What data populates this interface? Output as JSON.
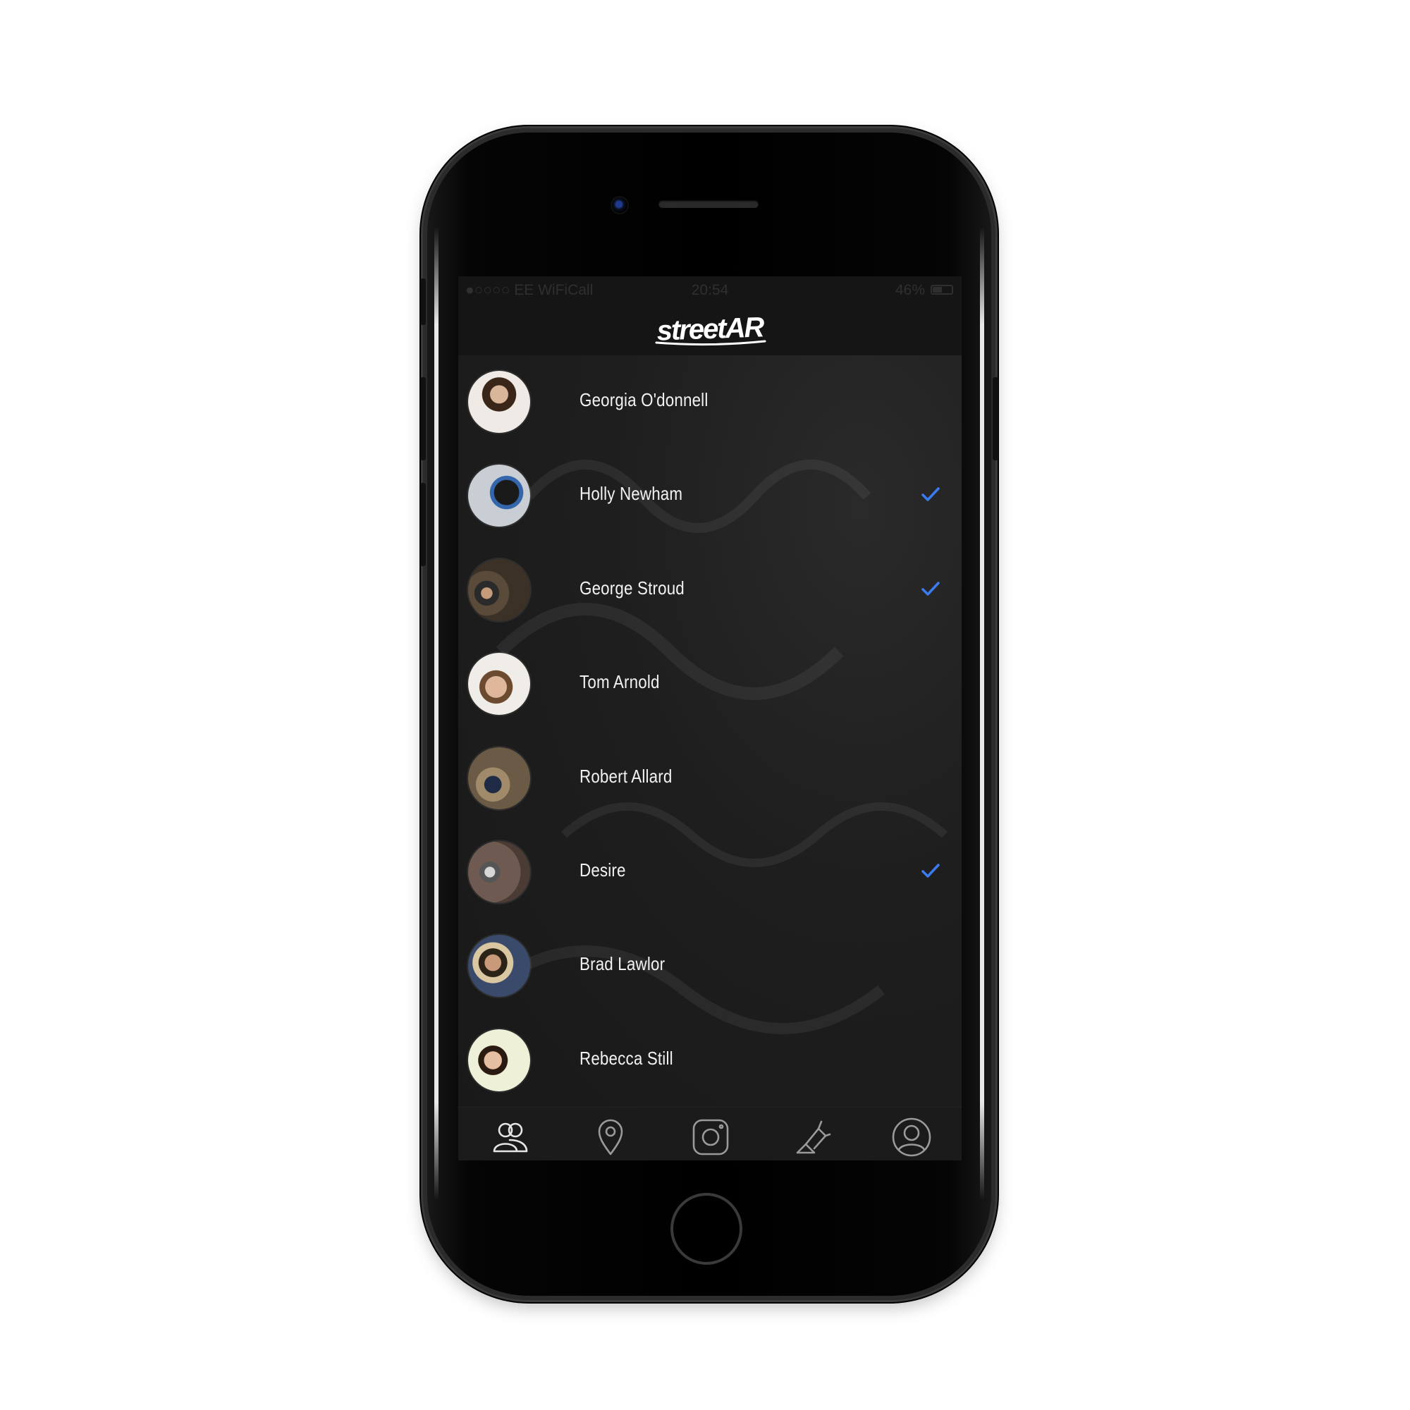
{
  "app": {
    "logo_text": "streetAR"
  },
  "status_bar": {
    "carrier": "●○○○○ EE WiFiCall",
    "time": "20:54",
    "battery": "46%"
  },
  "contacts": [
    {
      "name": "Georgia O'donnell",
      "selected": false
    },
    {
      "name": "Holly Newham",
      "selected": true
    },
    {
      "name": "George Stroud",
      "selected": true
    },
    {
      "name": "Tom Arnold",
      "selected": false
    },
    {
      "name": "Robert Allard",
      "selected": false
    },
    {
      "name": "Desire",
      "selected": true
    },
    {
      "name": "Brad Lawlor",
      "selected": false
    },
    {
      "name": "Rebecca Still",
      "selected": false
    }
  ],
  "tabs": [
    {
      "icon": "friends-icon",
      "active": true
    },
    {
      "icon": "location-pin-icon",
      "active": false
    },
    {
      "icon": "instagram-icon",
      "active": false
    },
    {
      "icon": "spray-can-icon",
      "active": false
    },
    {
      "icon": "profile-icon",
      "active": false
    }
  ],
  "colors": {
    "accent": "#3b7bf0",
    "background": "#1e1e1e",
    "text": "#f2f2f2"
  }
}
